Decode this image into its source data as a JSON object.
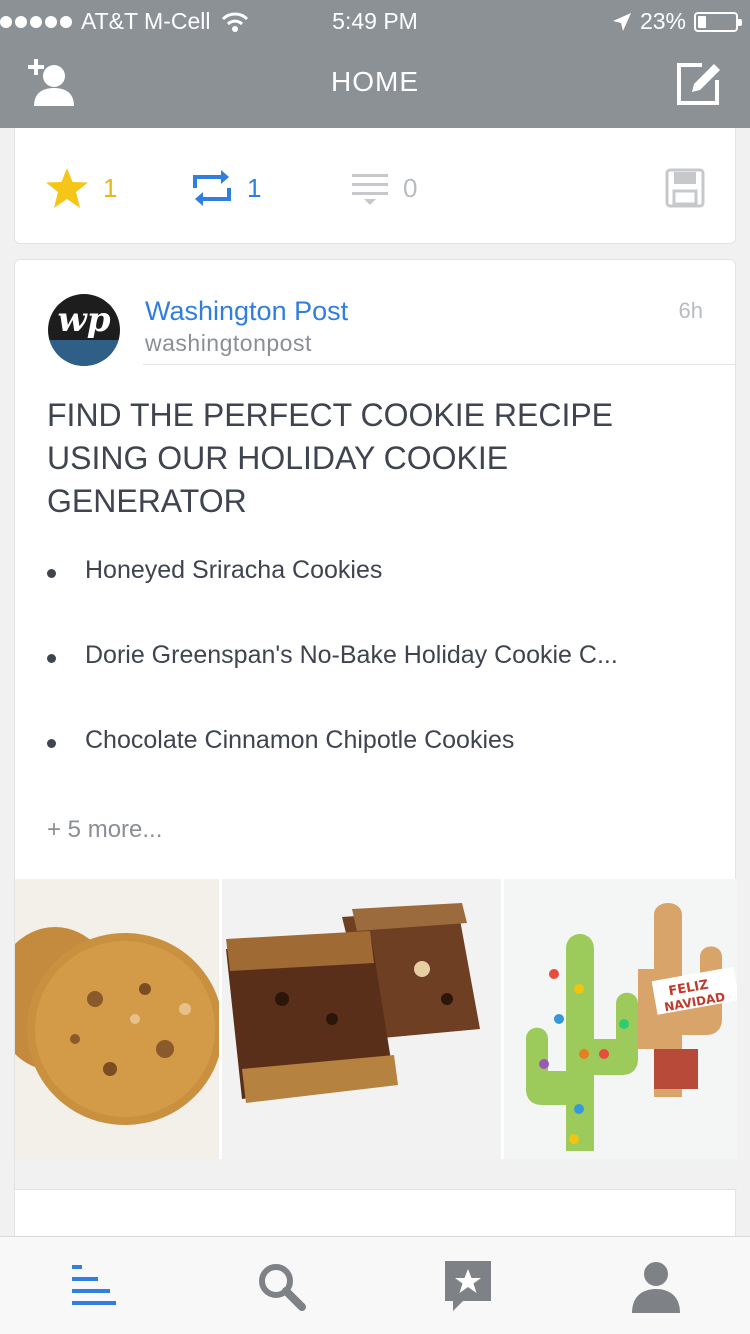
{
  "status_bar": {
    "signal_dots": 5,
    "carrier": "AT&T M-Cell",
    "time": "5:49 PM",
    "battery_percent": "23%",
    "battery_level": 0.23
  },
  "nav": {
    "title": "HOME",
    "left_icon": "add-user-icon",
    "right_icon": "compose-icon"
  },
  "colors": {
    "nav_bg": "#8c9196",
    "star": "#f5c518",
    "repost": "#2f7ee0",
    "link": "#2f7ee0",
    "muted": "#b8bbbf"
  },
  "previous_card": {
    "favorites": "1",
    "reposts": "1",
    "comments": "0"
  },
  "post": {
    "source_name": "Washington Post",
    "source_handle": "washingtonpost",
    "time_ago": "6h",
    "avatar_text": "wp",
    "headline": "FIND THE PERFECT COOKIE RECIPE USING OUR HOLIDAY COOKIE GENERATOR",
    "items": [
      "Honeyed Sriracha Cookies",
      "Dorie Greenspan's No-Bake Holiday Cookie C...",
      "Chocolate Cinnamon Chipotle Cookies"
    ],
    "more": "+ 5 more...",
    "images": [
      "cookie-photo",
      "fudge-bar-photo",
      "cactus-cookie-photo"
    ],
    "cactus_label_1": "FELIZ",
    "cactus_label_2": "NAVIDAD"
  },
  "tabbar": {
    "tabs": [
      "feed-icon",
      "search-icon",
      "favorites-icon",
      "profile-icon"
    ],
    "active": "feed-icon"
  }
}
